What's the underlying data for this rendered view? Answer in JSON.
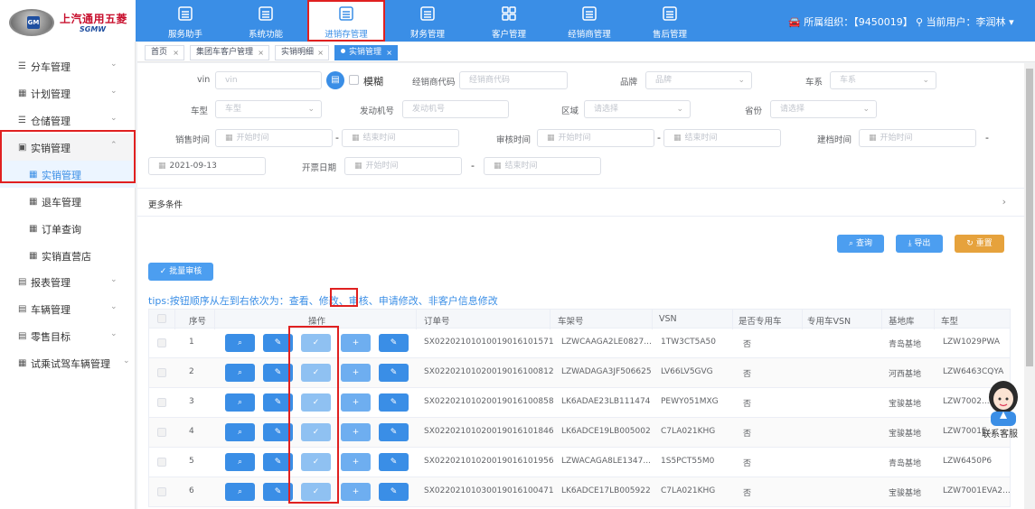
{
  "brand": {
    "name_cn": "上汽通用五菱",
    "name_en": "SGMW",
    "badge": "GM"
  },
  "topnav": [
    {
      "label": "服务助手",
      "icon": "clipboard-icon"
    },
    {
      "label": "系统功能",
      "icon": "clipboard-icon"
    },
    {
      "label": "进销存管理",
      "icon": "clipboard-icon",
      "active": true
    },
    {
      "label": "财务管理",
      "icon": "clipboard-icon"
    },
    {
      "label": "客户管理",
      "icon": "grid-icon"
    },
    {
      "label": "经销商管理",
      "icon": "clipboard-icon"
    },
    {
      "label": "售后管理",
      "icon": "clipboard-icon"
    }
  ],
  "header": {
    "org": "所属组织：【9450019】",
    "user": "当前用户：李润林"
  },
  "sidebar": {
    "items": [
      {
        "label": "分车管理"
      },
      {
        "label": "计划管理"
      },
      {
        "label": "仓储管理"
      },
      {
        "label": "实销管理"
      },
      {
        "label": "实销管理"
      },
      {
        "label": "退车管理"
      },
      {
        "label": "订单查询"
      },
      {
        "label": "实销直营店"
      },
      {
        "label": "报表管理"
      },
      {
        "label": "车辆管理"
      },
      {
        "label": "零售目标"
      },
      {
        "label": "试乘试驾车辆管理"
      }
    ]
  },
  "tabs": [
    {
      "label": "首页"
    },
    {
      "label": "集团车客户管理"
    },
    {
      "label": "实销明细"
    },
    {
      "label": "实销管理"
    }
  ],
  "filters": {
    "vin_label": "vin",
    "vin_placeholder": "vin",
    "fuzzy_label": "模糊",
    "dealer_code_label": "经销商代码",
    "dealer_code_placeholder": "经销商代码",
    "brand_label": "品牌",
    "brand_placeholder": "品牌",
    "series_label": "车系",
    "series_placeholder": "车系",
    "model_label": "车型",
    "model_placeholder": "车型",
    "engine_label": "发动机号",
    "engine_placeholder": "发动机号",
    "region_label": "区域",
    "region_placeholder": "请选择",
    "province_label": "省份",
    "province_placeholder": "请选择",
    "sale_time_label": "销售时间",
    "audit_time_label": "审核时间",
    "archive_time_label": "建档时间",
    "start_placeholder": "开始时间",
    "end_placeholder": "结束时间",
    "archive_date_value": "2021-09-13",
    "invoice_date_label": "开票日期",
    "dash": "-",
    "more_conditions": "更多条件"
  },
  "actions": {
    "query": "查询",
    "export": "导出",
    "reset": "重置",
    "batch_audit": "批量审核"
  },
  "tips": {
    "prefix": "tips:按钮顺序从左到右依次为：查看、修改、",
    "highlight": "审核",
    "suffix": "、申请修改、非客户信息修改"
  },
  "table": {
    "columns": [
      "序号",
      "操作",
      "订单号",
      "车架号",
      "VSN",
      "是否专用车",
      "专用车VSN",
      "基地库",
      "车型"
    ],
    "rows": [
      {
        "no": "1",
        "order": "SX02202101010019016101571",
        "frame": "LZWCAAGA2LE0827...",
        "vsn": "1TW3CT5A50",
        "special": "否",
        "special_vsn": "",
        "base": "青岛基地",
        "model": "LZW1029PWA"
      },
      {
        "no": "2",
        "order": "SX02202101020019016100812",
        "frame": "LZWADAGA3JF506625",
        "vsn": "LV66LV5GVG",
        "special": "否",
        "special_vsn": "",
        "base": "河西基地",
        "model": "LZW6463CQYA"
      },
      {
        "no": "3",
        "order": "SX02202101020019016100858",
        "frame": "LK6ADAE23LB111474",
        "vsn": "PEWY051MXG",
        "special": "否",
        "special_vsn": "",
        "base": "宝骏基地",
        "model": "LZW7002..."
      },
      {
        "no": "4",
        "order": "SX02202101020019016101846",
        "frame": "LK6ADCE19LB005002",
        "vsn": "C7LA021KHG",
        "special": "否",
        "special_vsn": "",
        "base": "宝骏基地",
        "model": "LZW7001E..."
      },
      {
        "no": "5",
        "order": "SX02202101020019016101956",
        "frame": "LZWACAGA8LE1347...",
        "vsn": "1S5PCT55M0",
        "special": "否",
        "special_vsn": "",
        "base": "青岛基地",
        "model": "LZW6450P6"
      },
      {
        "no": "6",
        "order": "SX02202101030019016100471",
        "frame": "LK6ADCE17LB005922",
        "vsn": "C7LA021KHG",
        "special": "否",
        "special_vsn": "",
        "base": "宝骏基地",
        "model": "LZW7001EVA2..."
      }
    ]
  },
  "customer_service": {
    "label": "联系客服"
  },
  "colors": {
    "primary": "#3a8ee6",
    "highlight_box": "#e02020",
    "reset": "#e6a23c"
  }
}
